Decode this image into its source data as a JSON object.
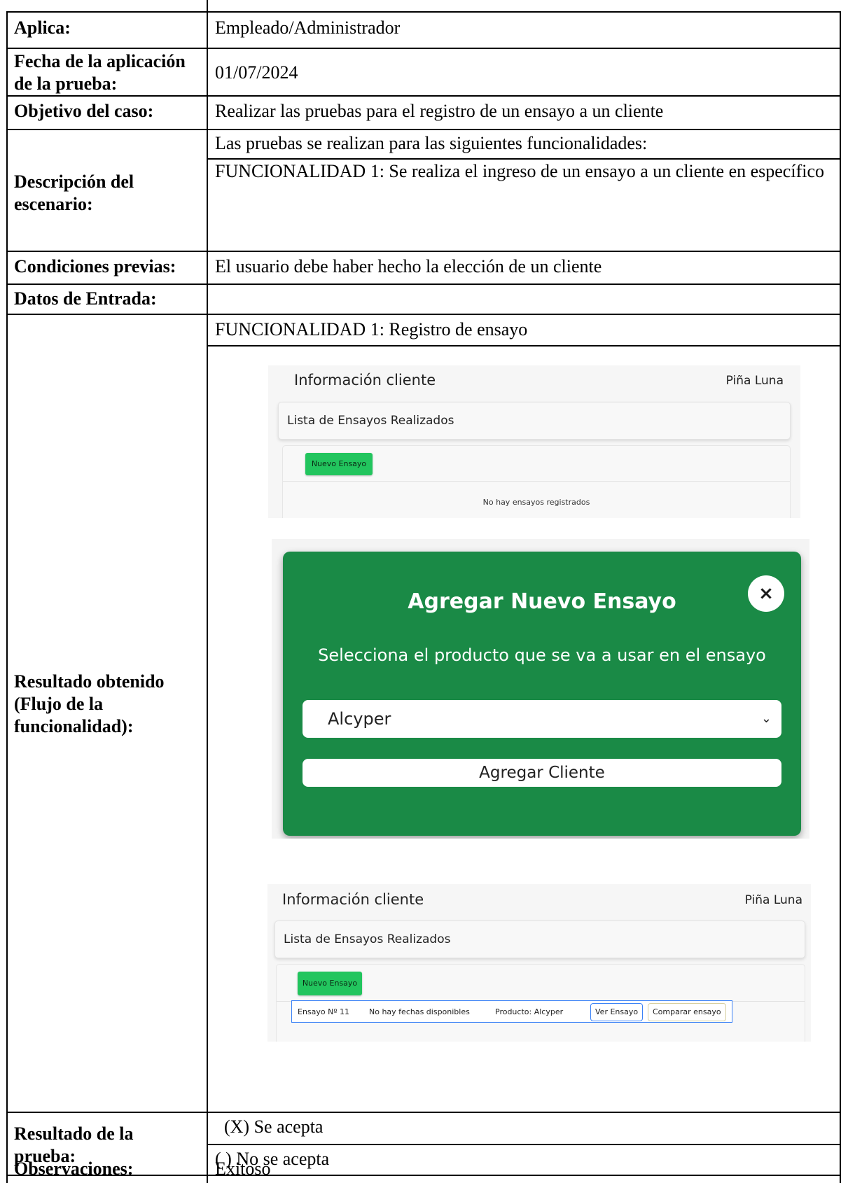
{
  "table": {
    "aplica": {
      "label": "Aplica:",
      "value": "Empleado/Administrador"
    },
    "fecha": {
      "label_line1": "Fecha de la aplicación",
      "label_line2": "de la prueba:",
      "value": "01/07/2024"
    },
    "objetivo": {
      "label": "Objetivo del caso:",
      "value": "Realizar las pruebas para el registro de un ensayo a un cliente"
    },
    "descripcion": {
      "label_line1": "Descripción del",
      "label_line2": "escenario:",
      "line1": "Las pruebas se realizan para las siguientes funcionalidades:",
      "line2": "FUNCIONALIDAD 1: Se realiza el ingreso de un ensayo a un cliente en específico"
    },
    "condiciones": {
      "label": "Condiciones previas:",
      "value": "El usuario debe haber hecho la elección de un cliente"
    },
    "datos": {
      "label": "Datos de Entrada:",
      "value": ""
    },
    "resultado_obtenido": {
      "label_line1": "Resultado obtenido",
      "label_line2": "(Flujo de la",
      "label_line3": "funcionalidad):",
      "heading": "FUNCIONALIDAD 1: Registro de ensayo"
    },
    "resultado_prueba": {
      "label_line1": "Resultado de la",
      "label_line2": "prueba:",
      "option_accept": "(X) Se acepta",
      "option_reject": "(  ) No se acepta"
    },
    "observaciones": {
      "label": "Observaciones:",
      "value": "Exitoso"
    }
  },
  "screenshot1": {
    "title": "Información cliente",
    "client_name": "Piña Luna",
    "list_header": "Lista de Ensayos Realizados",
    "new_button": "Nuevo Ensayo",
    "empty_message": "No hay ensayos registrados"
  },
  "screenshot2": {
    "modal_title": "Agregar Nuevo Ensayo",
    "close_glyph": "×",
    "subtitle": "Selecciona el producto que se va a usar en el ensayo",
    "selected_product": "Alcyper",
    "chevron_glyph": "⌄",
    "submit_button": "Agregar Cliente"
  },
  "screenshot3": {
    "title": "Información cliente",
    "client_name": "Piña Luna",
    "list_header": "Lista de Ensayos Realizados",
    "new_button": "Nuevo Ensayo",
    "row": {
      "ensayo": "Ensayo Nº 11",
      "fechas": "No hay fechas disponibles",
      "producto": "Producto: Alcyper",
      "view_button": "Ver Ensayo",
      "compare_button": "Comparar ensayo"
    }
  }
}
